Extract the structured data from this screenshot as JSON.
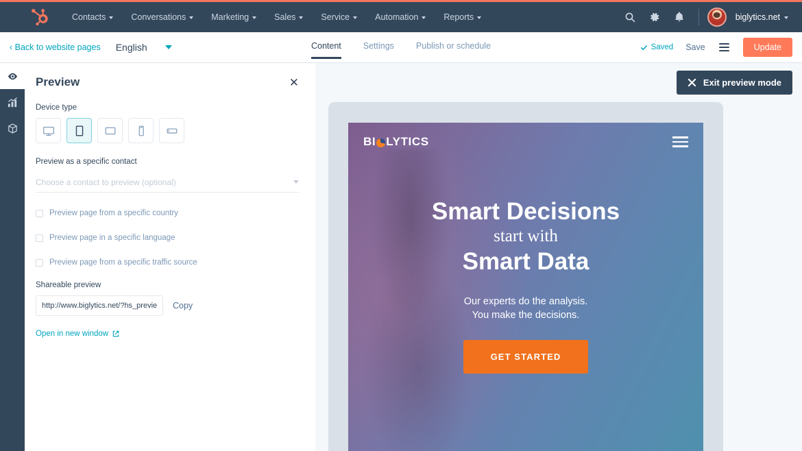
{
  "nav": {
    "logo_icon": "hubspot-sprocket-icon",
    "items": [
      {
        "label": "Contacts"
      },
      {
        "label": "Conversations"
      },
      {
        "label": "Marketing"
      },
      {
        "label": "Sales"
      },
      {
        "label": "Service"
      },
      {
        "label": "Automation"
      },
      {
        "label": "Reports"
      }
    ],
    "search_icon": "search-icon",
    "settings_icon": "gear-icon",
    "notifications_icon": "bell-icon",
    "avatar_icon": "user-avatar",
    "account": "biglytics.net"
  },
  "editor": {
    "back_label": "‹ Back to website pages",
    "language": "English",
    "tabs": [
      {
        "label": "Content",
        "active": true
      },
      {
        "label": "Settings",
        "active": false
      },
      {
        "label": "Publish or schedule",
        "active": false
      }
    ],
    "saved_label": "Saved",
    "saved_icon": "check-icon",
    "save_label": "Save",
    "menu_icon": "hamburger-menu-icon",
    "update_label": "Update"
  },
  "rail": {
    "items": [
      {
        "icon": "eye-icon",
        "name": "preview",
        "active": true
      },
      {
        "icon": "bar-chart-icon",
        "name": "optimize",
        "active": false
      },
      {
        "icon": "module-box-icon",
        "name": "modules",
        "active": false
      }
    ]
  },
  "panel": {
    "title": "Preview",
    "close_icon": "close-icon",
    "device_type_label": "Device type",
    "devices": [
      {
        "name": "desktop",
        "icon": "monitor-icon",
        "selected": false
      },
      {
        "name": "tablet-portrait",
        "icon": "tablet-portrait-icon",
        "selected": true
      },
      {
        "name": "tablet-landscape",
        "icon": "tablet-landscape-icon",
        "selected": false
      },
      {
        "name": "mobile-portrait",
        "icon": "mobile-portrait-icon",
        "selected": false
      },
      {
        "name": "mobile-landscape",
        "icon": "mobile-landscape-icon",
        "selected": false
      }
    ],
    "contact_label": "Preview as a specific contact",
    "contact_placeholder": "Choose a contact to preview (optional)",
    "options": [
      {
        "label": "Preview page from a specific country",
        "checked": false
      },
      {
        "label": "Preview page in a specific language",
        "checked": false
      },
      {
        "label": "Preview page from a specific traffic source",
        "checked": false
      }
    ],
    "shareable_label": "Shareable preview",
    "shareable_url": "http://www.biglytics.net/?hs_preview",
    "copy_label": "Copy",
    "open_window_label": "Open in new window",
    "open_window_icon": "external-link-icon"
  },
  "stage": {
    "exit_label": "Exit preview mode",
    "exit_icon": "close-x-icon"
  },
  "site": {
    "logo_text_before": "BI",
    "logo_text_after": "LYTICS",
    "menu_icon": "hamburger-menu-icon",
    "hero_line1": "Smart Decisions",
    "hero_line2": "start with",
    "hero_line3": "Smart Data",
    "hero_sub_line1": "Our experts do the analysis.",
    "hero_sub_line2": "You make the decisions.",
    "cta_label": "GET STARTED"
  },
  "colors": {
    "nav_bg": "#33475b",
    "accent_orange": "#ff7a59",
    "teal": "#00a4bd",
    "cta_orange": "#f2711c"
  }
}
